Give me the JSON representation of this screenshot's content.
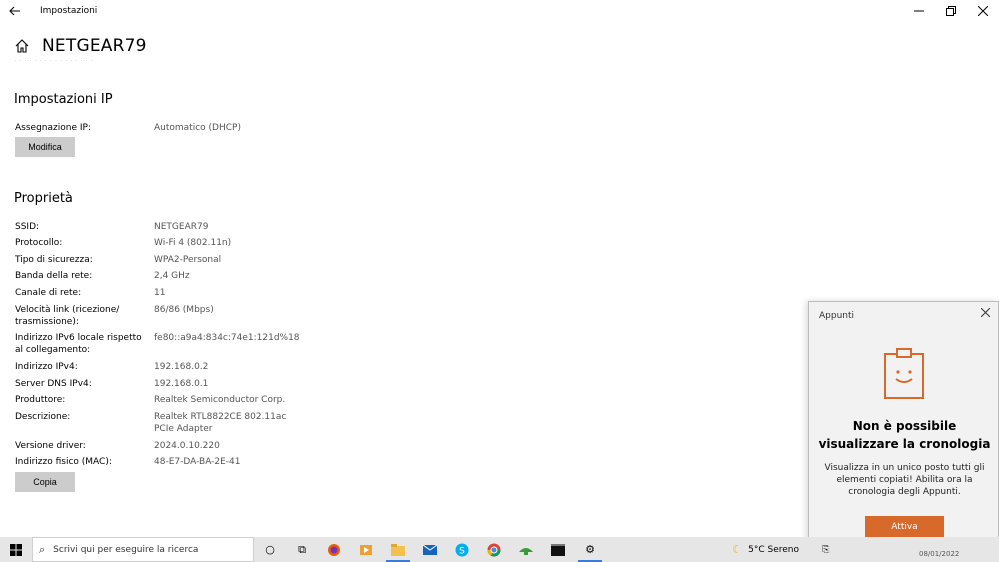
{
  "window": {
    "title": "Impostazioni",
    "back_icon": "back-arrow-icon",
    "controls": [
      "minimize-icon",
      "restore-icon",
      "close-icon"
    ]
  },
  "header": {
    "network_name": "NETGEAR79",
    "home_icon": "home-icon"
  },
  "ip_settings": {
    "heading": "Impostazioni IP",
    "assignment_label": "Assegnazione IP:",
    "assignment_value": "Automatico (DHCP)",
    "edit_button": "Modifica"
  },
  "properties": {
    "heading": "Proprietà",
    "rows": [
      {
        "label": "SSID:",
        "value": "NETGEAR79"
      },
      {
        "label": "Protocollo:",
        "value": "Wi-Fi 4 (802.11n)"
      },
      {
        "label": "Tipo di sicurezza:",
        "value": "WPA2-Personal"
      },
      {
        "label": "Banda della rete:",
        "value": "2,4 GHz"
      },
      {
        "label": "Canale di rete:",
        "value": "11"
      },
      {
        "label": "Velocità link (ricezione/ trasmissione):",
        "value": "86/86 (Mbps)"
      },
      {
        "label": "Indirizzo IPv6 locale rispetto al collegamento:",
        "value": "fe80::a9a4:834c:74e1:121d%18"
      },
      {
        "label": "Indirizzo IPv4:",
        "value": "192.168.0.2"
      },
      {
        "label": "Server DNS IPv4:",
        "value": "192.168.0.1"
      },
      {
        "label": "Produttore:",
        "value": "Realtek Semiconductor Corp."
      },
      {
        "label": "Descrizione:",
        "value": "Realtek RTL8822CE 802.11ac PCIe Adapter"
      },
      {
        "label": "Versione driver:",
        "value": "2024.0.10.220"
      },
      {
        "label": "Indirizzo fisico (MAC):",
        "value": "48-E7-DA-BA-2E-41"
      }
    ],
    "copy_button": "Copia"
  },
  "clipboard_panel": {
    "title": "Appunti",
    "heading_line1": "Non è possibile",
    "heading_line2": "visualizzare la cronologia",
    "body": "Visualizza in un unico posto tutti gli elementi copiati! Abilita ora la cronologia degli Appunti.",
    "button": "Attiva",
    "accent_color": "#d7692a"
  },
  "taskbar": {
    "search_placeholder": "Scrivi qui per eseguire la ricerca",
    "weather": "5°C  Sereno",
    "date_fragment": "08/01/2022"
  }
}
